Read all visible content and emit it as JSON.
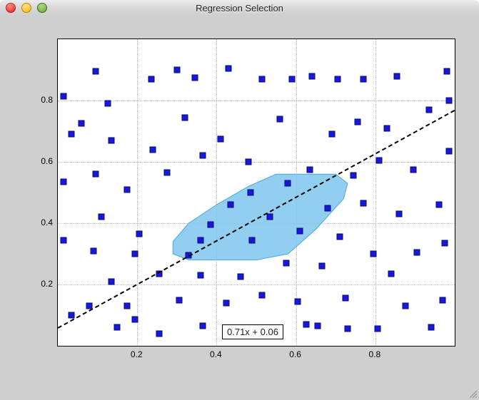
{
  "window": {
    "title": "Regression Selection"
  },
  "chart_data": {
    "type": "scatter",
    "xlim": [
      0.0,
      1.0
    ],
    "ylim": [
      0.0,
      1.0
    ],
    "x_ticks": [
      0.2,
      0.4,
      0.6,
      0.8
    ],
    "y_ticks": [
      0.2,
      0.4,
      0.6,
      0.8
    ],
    "grid": true,
    "regression": {
      "slope": 0.71,
      "intercept": 0.06,
      "label": "0.71x + 0.06"
    },
    "selection_polygon": [
      [
        0.29,
        0.3
      ],
      [
        0.33,
        0.28
      ],
      [
        0.42,
        0.28
      ],
      [
        0.5,
        0.28
      ],
      [
        0.58,
        0.3
      ],
      [
        0.65,
        0.38
      ],
      [
        0.72,
        0.48
      ],
      [
        0.73,
        0.53
      ],
      [
        0.7,
        0.56
      ],
      [
        0.62,
        0.56
      ],
      [
        0.55,
        0.56
      ],
      [
        0.48,
        0.52
      ],
      [
        0.4,
        0.46
      ],
      [
        0.33,
        0.4
      ],
      [
        0.29,
        0.34
      ]
    ],
    "points": [
      [
        0.015,
        0.815
      ],
      [
        0.015,
        0.535
      ],
      [
        0.015,
        0.345
      ],
      [
        0.035,
        0.69
      ],
      [
        0.035,
        0.1
      ],
      [
        0.06,
        0.725
      ],
      [
        0.08,
        0.13
      ],
      [
        0.09,
        0.31
      ],
      [
        0.095,
        0.895
      ],
      [
        0.095,
        0.56
      ],
      [
        0.11,
        0.42
      ],
      [
        0.125,
        0.79
      ],
      [
        0.135,
        0.67
      ],
      [
        0.135,
        0.21
      ],
      [
        0.15,
        0.06
      ],
      [
        0.175,
        0.51
      ],
      [
        0.175,
        0.13
      ],
      [
        0.195,
        0.3
      ],
      [
        0.195,
        0.085
      ],
      [
        0.205,
        0.365
      ],
      [
        0.24,
        0.64
      ],
      [
        0.235,
        0.87
      ],
      [
        0.255,
        0.235
      ],
      [
        0.255,
        0.04
      ],
      [
        0.275,
        0.565
      ],
      [
        0.305,
        0.15
      ],
      [
        0.3,
        0.9
      ],
      [
        0.32,
        0.745
      ],
      [
        0.33,
        0.295
      ],
      [
        0.345,
        0.875
      ],
      [
        0.36,
        0.23
      ],
      [
        0.36,
        0.345
      ],
      [
        0.365,
        0.62
      ],
      [
        0.365,
        0.065
      ],
      [
        0.385,
        0.395
      ],
      [
        0.41,
        0.675
      ],
      [
        0.425,
        0.14
      ],
      [
        0.43,
        0.905
      ],
      [
        0.435,
        0.46
      ],
      [
        0.46,
        0.225
      ],
      [
        0.48,
        0.6
      ],
      [
        0.485,
        0.5
      ],
      [
        0.49,
        0.345
      ],
      [
        0.505,
        0.04
      ],
      [
        0.515,
        0.87
      ],
      [
        0.515,
        0.165
      ],
      [
        0.535,
        0.42
      ],
      [
        0.56,
        0.74
      ],
      [
        0.56,
        0.055
      ],
      [
        0.575,
        0.27
      ],
      [
        0.58,
        0.53
      ],
      [
        0.59,
        0.87
      ],
      [
        0.605,
        0.145
      ],
      [
        0.61,
        0.375
      ],
      [
        0.625,
        0.07
      ],
      [
        0.635,
        0.575
      ],
      [
        0.64,
        0.88
      ],
      [
        0.655,
        0.065
      ],
      [
        0.665,
        0.26
      ],
      [
        0.68,
        0.45
      ],
      [
        0.69,
        0.69
      ],
      [
        0.705,
        0.87
      ],
      [
        0.71,
        0.355
      ],
      [
        0.725,
        0.155
      ],
      [
        0.73,
        0.055
      ],
      [
        0.745,
        0.555
      ],
      [
        0.755,
        0.73
      ],
      [
        0.77,
        0.465
      ],
      [
        0.77,
        0.87
      ],
      [
        0.795,
        0.3
      ],
      [
        0.805,
        0.055
      ],
      [
        0.81,
        0.605
      ],
      [
        0.83,
        0.71
      ],
      [
        0.84,
        0.235
      ],
      [
        0.855,
        0.88
      ],
      [
        0.86,
        0.43
      ],
      [
        0.875,
        0.13
      ],
      [
        0.895,
        0.575
      ],
      [
        0.905,
        0.305
      ],
      [
        0.935,
        0.77
      ],
      [
        0.94,
        0.06
      ],
      [
        0.96,
        0.46
      ],
      [
        0.97,
        0.15
      ],
      [
        0.975,
        0.335
      ],
      [
        0.98,
        0.895
      ],
      [
        0.985,
        0.635
      ],
      [
        0.985,
        0.8
      ]
    ]
  }
}
